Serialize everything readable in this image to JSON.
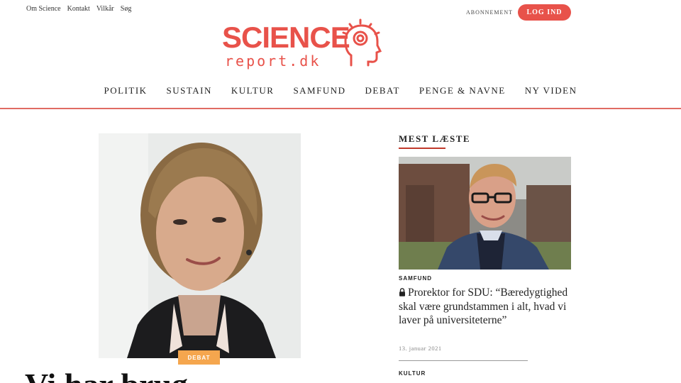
{
  "header": {
    "top_links": [
      "Om Science",
      "Kontakt",
      "Vilkår",
      "Søg"
    ],
    "subscribe_label": "ABONNEMENT",
    "login_label": "LOG IND",
    "logo": {
      "name": "SCIENCE",
      "sub": "report.dk",
      "icon": "head-lightbulb-icon"
    },
    "accent_color": "#e8524a"
  },
  "nav": {
    "items": [
      "POLITIK",
      "SUSTAIN",
      "KULTUR",
      "SAMFUND",
      "DEBAT",
      "PENGE & NAVNE",
      "NY VIDEN"
    ]
  },
  "main": {
    "badge": "DEBAT",
    "headline": "Vi har brug"
  },
  "sidebar": {
    "heading": "MEST LÆSTE",
    "article": {
      "category": "SAMFUND",
      "title": "Prorektor for SDU: “Bæredygtighed skal være grundstammen i alt, hvad vi laver på universiteterne”",
      "date": "13. januar 2021",
      "lock_icon": "lock-icon"
    },
    "next_category": "KULTUR"
  }
}
